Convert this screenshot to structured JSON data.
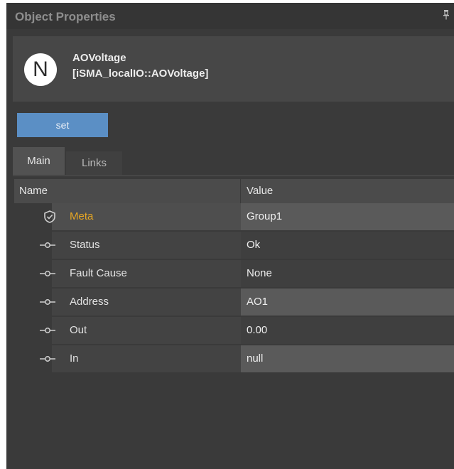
{
  "panel": {
    "title": "Object Properties",
    "pin_icon": "pin-icon"
  },
  "object": {
    "icon_letter": "N",
    "name": "AOVoltage",
    "path": "[iSMA_localIO::AOVoltage]"
  },
  "toolbar": {
    "set_label": "set"
  },
  "tabs": [
    {
      "label": "Main",
      "active": true
    },
    {
      "label": "Links",
      "active": false
    }
  ],
  "table": {
    "columns": [
      "Name",
      "Value"
    ],
    "rows": [
      {
        "icon": "shield-icon",
        "name": "Meta",
        "value": "Group1",
        "editable": true
      },
      {
        "icon": "slot-icon",
        "name": "Status",
        "value": "Ok",
        "editable": false
      },
      {
        "icon": "slot-icon",
        "name": "Fault Cause",
        "value": "None",
        "editable": false
      },
      {
        "icon": "slot-icon",
        "name": "Address",
        "value": "AO1",
        "editable": true
      },
      {
        "icon": "slot-icon",
        "name": "Out",
        "value": "0.00",
        "editable": false
      },
      {
        "icon": "slot-icon",
        "name": "In",
        "value": "null",
        "editable": true
      }
    ]
  },
  "colors": {
    "accent_button": "#5b8fc5",
    "meta_label": "#e6a623",
    "panel_background": "#3a3a3a"
  }
}
